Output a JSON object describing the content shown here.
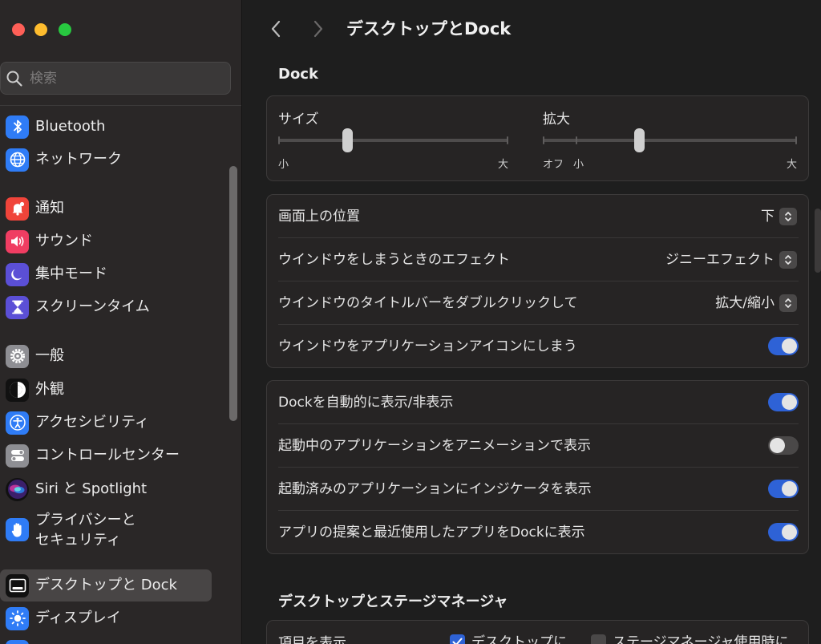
{
  "window": {
    "title": "デスクトップとDock"
  },
  "search": {
    "placeholder": "検索"
  },
  "sidebar": {
    "items": [
      {
        "label": "Bluetooth",
        "icon": "bluetooth-icon",
        "color": "#2f7cf6"
      },
      {
        "label": "ネットワーク",
        "icon": "globe-icon",
        "color": "#2f7cf6"
      },
      {
        "label": "通知",
        "icon": "bell-icon",
        "color": "#f0443a"
      },
      {
        "label": "サウンド",
        "icon": "speaker-icon",
        "color": "#f03d62"
      },
      {
        "label": "集中モード",
        "icon": "moon-icon",
        "color": "#5b4fd6"
      },
      {
        "label": "スクリーンタイム",
        "icon": "hourglass-icon",
        "color": "#5b4fd6"
      },
      {
        "label": "一般",
        "icon": "gear-icon",
        "color": "#8e8e93"
      },
      {
        "label": "外観",
        "icon": "appearance-icon",
        "color": "#111111"
      },
      {
        "label": "アクセシビリティ",
        "icon": "accessibility-icon",
        "color": "#2f7cf6"
      },
      {
        "label": "コントロールセンター",
        "icon": "control-center-icon",
        "color": "#8e8e93"
      },
      {
        "label": "Siri と Spotlight",
        "icon": "siri-icon",
        "color": "#6a3fd0"
      },
      {
        "label_line1": "プライバシーと",
        "label_line2": "セキュリティ",
        "icon": "hand-icon",
        "color": "#2f7cf6"
      },
      {
        "label": "デスクトップと Dock",
        "icon": "dock-icon",
        "color": "#111111",
        "selected": true
      },
      {
        "label": "ディスプレイ",
        "icon": "sun-icon",
        "color": "#2f7cf6"
      }
    ]
  },
  "dock": {
    "section_title": "Dock",
    "size": {
      "label": "サイズ",
      "min_label": "小",
      "max_label": "大",
      "level": 0.3
    },
    "magnification": {
      "label": "拡大",
      "off_label": "オフ",
      "min_label": "小",
      "max_label": "大",
      "level": 0.38
    },
    "settings1": [
      {
        "label": "画面上の位置",
        "value": "下"
      },
      {
        "label": "ウインドウをしまうときのエフェクト",
        "value": "ジニーエフェクト"
      },
      {
        "label": "ウインドウのタイトルバーをダブルクリックして",
        "value": "拡大/縮小"
      },
      {
        "label": "ウインドウをアプリケーションアイコンにしまう",
        "toggle": true
      }
    ],
    "settings2": [
      {
        "label": "Dockを自動的に表示/非表示",
        "toggle": true
      },
      {
        "label": "起動中のアプリケーションをアニメーションで表示",
        "toggle": false
      },
      {
        "label": "起動済みのアプリケーションにインジケータを表示",
        "toggle": true
      },
      {
        "label": "アプリの提案と最近使用したアプリをDockに表示",
        "toggle": true
      }
    ]
  },
  "stage": {
    "section_title": "デスクトップとステージマネージャ",
    "show_items_label": "項目を表示",
    "option1": {
      "label": "デスクトップに",
      "checked": true
    },
    "option2": {
      "label": "ステージマネージャ使用時に",
      "checked": false
    }
  }
}
